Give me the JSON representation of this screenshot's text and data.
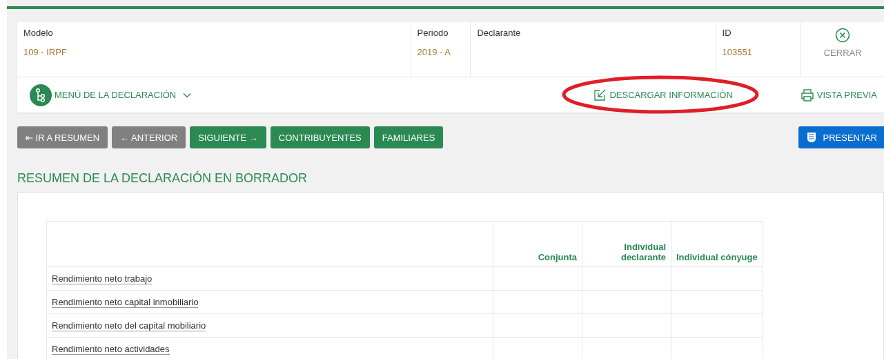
{
  "header": {
    "fields": [
      {
        "label": "Modelo",
        "value": "109 - IRPF"
      },
      {
        "label": "Periodo",
        "value": "2019 - A"
      },
      {
        "label": "Declarante"
      },
      {
        "label": "ID",
        "value": "103551"
      }
    ],
    "close": "CERRAR"
  },
  "menu_bar": {
    "menu": "MENÚ DE LA DECLARACIÓN",
    "download": {
      "label": "DESCARGAR INFORMACIÓN",
      "highlighted": true
    },
    "preview": "VISTA PREVIA"
  },
  "buttons": [
    {
      "label": "⇤ IR A RESUMEN",
      "kind": "grey"
    },
    {
      "label": "← ANTERIOR",
      "kind": "grey"
    },
    {
      "label": "SIGUIENTE →",
      "kind": "green"
    },
    {
      "label": "CONTRIBUYENTES",
      "kind": "green"
    },
    {
      "label": "FAMILIARES",
      "kind": "green"
    }
  ],
  "submit": "PRESENTAR",
  "section_title": "RESUMEN DE LA DECLARACIÓN EN BORRADOR",
  "table": {
    "columns": [
      "Conjunta",
      "Individual declarante",
      "Individual cónyuge"
    ],
    "rows": [
      "Rendimiento neto trabajo",
      "Rendimiento neto capital inmobiliario",
      "Rendimiento neto del capital mobiliario",
      "Rendimiento neto actividades"
    ]
  }
}
